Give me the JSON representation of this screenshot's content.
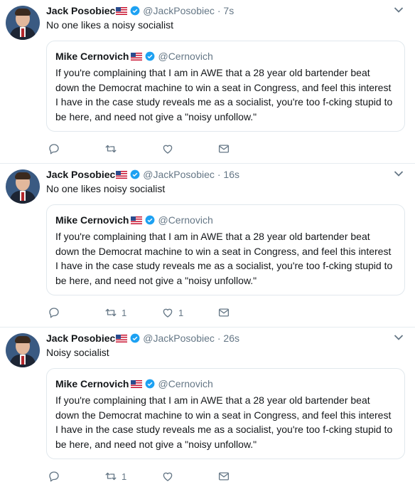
{
  "tweets": [
    {
      "author_name": "Jack Posobiec",
      "author_handle": "@JackPosobiec",
      "time": "· 7s",
      "text": "No one likes a noisy socialist",
      "quote": {
        "author_name": "Mike Cernovich",
        "author_handle": "@Cernovich",
        "text": "If you're complaining that I am in AWE that a 28 year old bartender beat down the Democrat machine to win a seat in Congress, and feel this interest I have in the case study reveals me as a socialist, you're too f-cking stupid to be here, and need not give a \"noisy unfollow.\""
      },
      "retweets": "",
      "likes": ""
    },
    {
      "author_name": "Jack Posobiec",
      "author_handle": "@JackPosobiec",
      "time": "· 16s",
      "text": "No one likes noisy socialist",
      "quote": {
        "author_name": "Mike Cernovich",
        "author_handle": "@Cernovich",
        "text": "If you're complaining that I am in AWE that a 28 year old bartender beat down the Democrat machine to win a seat in Congress, and feel this interest I have in the case study reveals me as a socialist, you're too f-cking stupid to be here, and need not give a \"noisy unfollow.\""
      },
      "retweets": "1",
      "likes": "1"
    },
    {
      "author_name": "Jack Posobiec",
      "author_handle": "@JackPosobiec",
      "time": "· 26s",
      "text": "Noisy socialist",
      "quote": {
        "author_name": "Mike Cernovich",
        "author_handle": "@Cernovich",
        "text": "If you're complaining that I am in AWE that a 28 year old bartender beat down the Democrat machine to win a seat in Congress, and feel this interest I have in the case study reveals me as a socialist, you're too f-cking stupid to be here, and need not give a \"noisy unfollow.\""
      },
      "retweets": "1",
      "likes": ""
    }
  ],
  "icons": {
    "verified": "verified-badge-icon",
    "flag": "us-flag-icon",
    "more": "chevron-down-icon",
    "reply": "reply-icon",
    "retweet": "retweet-icon",
    "like": "heart-icon",
    "dm": "envelope-icon"
  },
  "colors": {
    "accent": "#1da1f2",
    "muted": "#657786",
    "border": "#e1e8ed",
    "text": "#14171a"
  }
}
